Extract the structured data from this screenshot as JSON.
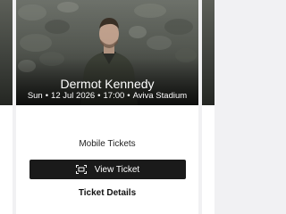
{
  "event": {
    "artist": "Dermot Kennedy",
    "day": "Sun",
    "date": "12 Jul 2026",
    "time": "17:00",
    "venue": "Aviva Stadium",
    "separator": "•"
  },
  "tickets": {
    "mobile_label": "Mobile Tickets",
    "view_button_label": "View Ticket",
    "details_link_label": "Ticket Details"
  },
  "icons": {
    "view_ticket": "ticket-scan-icon"
  },
  "colors": {
    "button_bg": "#1a1a1a",
    "card_bg": "#ffffff",
    "page_bg": "#f1f1f3"
  }
}
